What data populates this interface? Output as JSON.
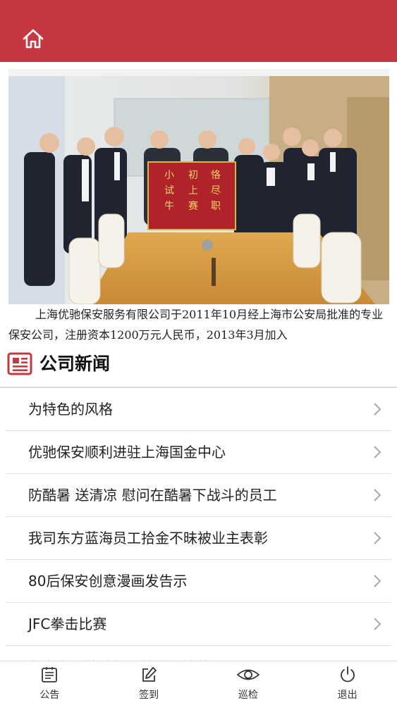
{
  "header": {
    "home_icon": "home-icon",
    "background": "#c6373f"
  },
  "intro": {
    "text": "上海优驰保安服务有限公司于2011年10月经上海市公安局批准的专业保安公司，注册资本1200万元人民币，2013年3月加入"
  },
  "banner": {
    "flag_lines": [
      "恪尽职守",
      "初上赛场",
      "小试牛刀"
    ]
  },
  "news_section": {
    "icon": "newspaper-icon",
    "title": "公司新闻",
    "items": [
      {
        "title": "为特色的风格"
      },
      {
        "title": "优驰保安顺利进驻上海国金中心"
      },
      {
        "title": "防酷暑 送清凉 慰问在酷暑下战斗的员工"
      },
      {
        "title": "我司东方蓝海员工拾金不昧被业主表彰"
      },
      {
        "title": "80后保安创意漫画发告示"
      },
      {
        "title": "JFC拳击比赛"
      },
      {
        "title": "保安人员消防知识培训与演练"
      }
    ]
  },
  "tabbar": {
    "tabs": [
      {
        "label": "公告",
        "icon": "notice-icon"
      },
      {
        "label": "签到",
        "icon": "sign-in-icon"
      },
      {
        "label": "巡检",
        "icon": "patrol-eye-icon"
      },
      {
        "label": "退出",
        "icon": "power-icon"
      }
    ]
  }
}
